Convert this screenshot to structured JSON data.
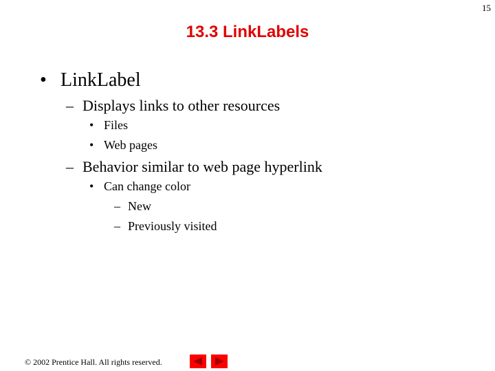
{
  "slide_number": "15",
  "title": "13.3 LinkLabels",
  "bullets": {
    "main": {
      "marker": "•",
      "text": "LinkLabel"
    },
    "sub1": {
      "marker": "–",
      "text": "Displays links to other resources"
    },
    "sub1_items": [
      {
        "marker": "•",
        "text": "Files"
      },
      {
        "marker": "•",
        "text": "Web pages"
      }
    ],
    "sub2": {
      "marker": "–",
      "text": "Behavior similar to web page hyperlink"
    },
    "sub2_item": {
      "marker": "•",
      "text": "Can change color"
    },
    "sub2_subitems": [
      {
        "marker": "–",
        "text": "New"
      },
      {
        "marker": "–",
        "text": "Previously visited"
      }
    ]
  },
  "footer": {
    "copyright": "© 2002 Prentice Hall.  All rights reserved."
  },
  "nav": {
    "prev_icon": "triangle-left",
    "next_icon": "triangle-right",
    "button_color": "#ff0000",
    "arrow_color": "#a00000"
  },
  "colors": {
    "title": "#e00000",
    "text": "#000000",
    "background": "#ffffff"
  }
}
